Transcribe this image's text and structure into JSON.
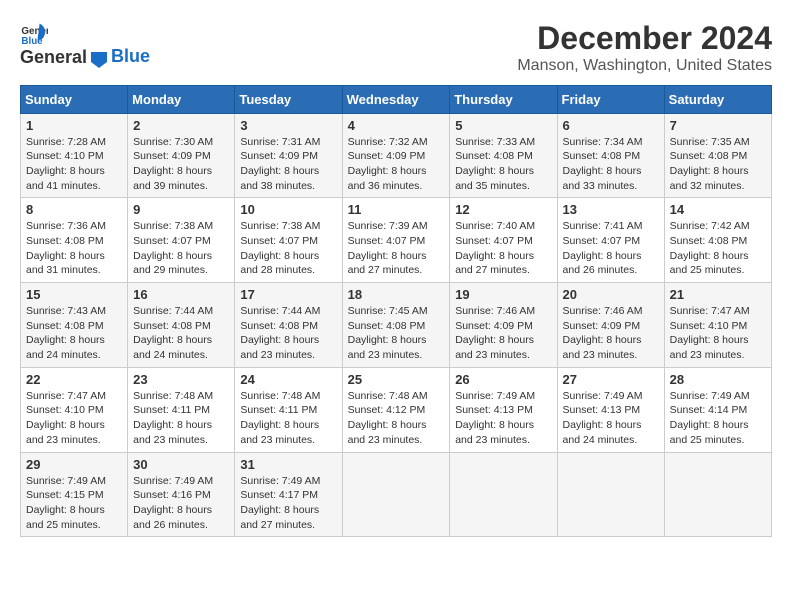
{
  "logo": {
    "general": "General",
    "blue": "Blue"
  },
  "title": "December 2024",
  "location": "Manson, Washington, United States",
  "days_header": [
    "Sunday",
    "Monday",
    "Tuesday",
    "Wednesday",
    "Thursday",
    "Friday",
    "Saturday"
  ],
  "weeks": [
    [
      {
        "day": "1",
        "sunrise": "7:28 AM",
        "sunset": "4:10 PM",
        "daylight": "8 hours and 41 minutes."
      },
      {
        "day": "2",
        "sunrise": "7:30 AM",
        "sunset": "4:09 PM",
        "daylight": "8 hours and 39 minutes."
      },
      {
        "day": "3",
        "sunrise": "7:31 AM",
        "sunset": "4:09 PM",
        "daylight": "8 hours and 38 minutes."
      },
      {
        "day": "4",
        "sunrise": "7:32 AM",
        "sunset": "4:09 PM",
        "daylight": "8 hours and 36 minutes."
      },
      {
        "day": "5",
        "sunrise": "7:33 AM",
        "sunset": "4:08 PM",
        "daylight": "8 hours and 35 minutes."
      },
      {
        "day": "6",
        "sunrise": "7:34 AM",
        "sunset": "4:08 PM",
        "daylight": "8 hours and 33 minutes."
      },
      {
        "day": "7",
        "sunrise": "7:35 AM",
        "sunset": "4:08 PM",
        "daylight": "8 hours and 32 minutes."
      }
    ],
    [
      {
        "day": "8",
        "sunrise": "7:36 AM",
        "sunset": "4:08 PM",
        "daylight": "8 hours and 31 minutes."
      },
      {
        "day": "9",
        "sunrise": "7:38 AM",
        "sunset": "4:07 PM",
        "daylight": "8 hours and 29 minutes."
      },
      {
        "day": "10",
        "sunrise": "7:38 AM",
        "sunset": "4:07 PM",
        "daylight": "8 hours and 28 minutes."
      },
      {
        "day": "11",
        "sunrise": "7:39 AM",
        "sunset": "4:07 PM",
        "daylight": "8 hours and 27 minutes."
      },
      {
        "day": "12",
        "sunrise": "7:40 AM",
        "sunset": "4:07 PM",
        "daylight": "8 hours and 27 minutes."
      },
      {
        "day": "13",
        "sunrise": "7:41 AM",
        "sunset": "4:07 PM",
        "daylight": "8 hours and 26 minutes."
      },
      {
        "day": "14",
        "sunrise": "7:42 AM",
        "sunset": "4:08 PM",
        "daylight": "8 hours and 25 minutes."
      }
    ],
    [
      {
        "day": "15",
        "sunrise": "7:43 AM",
        "sunset": "4:08 PM",
        "daylight": "8 hours and 24 minutes."
      },
      {
        "day": "16",
        "sunrise": "7:44 AM",
        "sunset": "4:08 PM",
        "daylight": "8 hours and 24 minutes."
      },
      {
        "day": "17",
        "sunrise": "7:44 AM",
        "sunset": "4:08 PM",
        "daylight": "8 hours and 23 minutes."
      },
      {
        "day": "18",
        "sunrise": "7:45 AM",
        "sunset": "4:08 PM",
        "daylight": "8 hours and 23 minutes."
      },
      {
        "day": "19",
        "sunrise": "7:46 AM",
        "sunset": "4:09 PM",
        "daylight": "8 hours and 23 minutes."
      },
      {
        "day": "20",
        "sunrise": "7:46 AM",
        "sunset": "4:09 PM",
        "daylight": "8 hours and 23 minutes."
      },
      {
        "day": "21",
        "sunrise": "7:47 AM",
        "sunset": "4:10 PM",
        "daylight": "8 hours and 23 minutes."
      }
    ],
    [
      {
        "day": "22",
        "sunrise": "7:47 AM",
        "sunset": "4:10 PM",
        "daylight": "8 hours and 23 minutes."
      },
      {
        "day": "23",
        "sunrise": "7:48 AM",
        "sunset": "4:11 PM",
        "daylight": "8 hours and 23 minutes."
      },
      {
        "day": "24",
        "sunrise": "7:48 AM",
        "sunset": "4:11 PM",
        "daylight": "8 hours and 23 minutes."
      },
      {
        "day": "25",
        "sunrise": "7:48 AM",
        "sunset": "4:12 PM",
        "daylight": "8 hours and 23 minutes."
      },
      {
        "day": "26",
        "sunrise": "7:49 AM",
        "sunset": "4:13 PM",
        "daylight": "8 hours and 23 minutes."
      },
      {
        "day": "27",
        "sunrise": "7:49 AM",
        "sunset": "4:13 PM",
        "daylight": "8 hours and 24 minutes."
      },
      {
        "day": "28",
        "sunrise": "7:49 AM",
        "sunset": "4:14 PM",
        "daylight": "8 hours and 25 minutes."
      }
    ],
    [
      {
        "day": "29",
        "sunrise": "7:49 AM",
        "sunset": "4:15 PM",
        "daylight": "8 hours and 25 minutes."
      },
      {
        "day": "30",
        "sunrise": "7:49 AM",
        "sunset": "4:16 PM",
        "daylight": "8 hours and 26 minutes."
      },
      {
        "day": "31",
        "sunrise": "7:49 AM",
        "sunset": "4:17 PM",
        "daylight": "8 hours and 27 minutes."
      },
      null,
      null,
      null,
      null
    ]
  ],
  "labels": {
    "sunrise": "Sunrise:",
    "sunset": "Sunset:",
    "daylight": "Daylight:"
  }
}
